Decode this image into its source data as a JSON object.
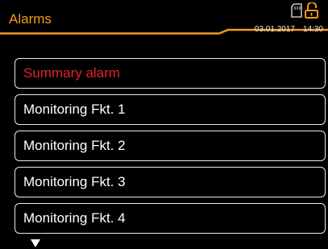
{
  "header": {
    "title": "Alarms",
    "date": "03.01.2017",
    "time": "14:30",
    "icons": [
      "sd-card-icon",
      "lock-open-icon"
    ]
  },
  "alarms": [
    {
      "label": "Summary alarm",
      "active": true
    },
    {
      "label": "Monitoring Fkt. 1",
      "active": false
    },
    {
      "label": "Monitoring Fkt. 2",
      "active": false
    },
    {
      "label": "Monitoring Fkt. 3",
      "active": false
    },
    {
      "label": "Monitoring Fkt. 4",
      "active": false
    }
  ],
  "colors": {
    "accent": "#f39a1e",
    "alarm_active": "#e4222c",
    "background": "#000000",
    "border": "#e9e9e9"
  },
  "scroll_indicator": "down-triangle-icon"
}
